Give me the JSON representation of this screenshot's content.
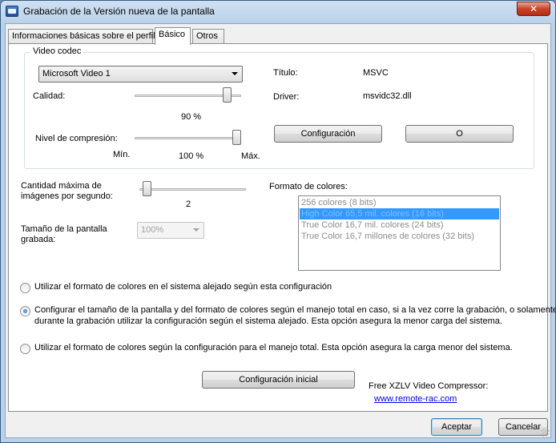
{
  "window": {
    "title": "Grabación de la Versión nueva de la pantalla",
    "close_label": "✕"
  },
  "tabs": [
    {
      "label": "Informaciones básicas sobre el perfil"
    },
    {
      "label": "Básico"
    },
    {
      "label": "Otros"
    }
  ],
  "video_codec": {
    "legend": "Video codec",
    "codec_value": "Microsoft Video 1",
    "quality_label": "Calidad:",
    "quality_value": "90 %",
    "compression_label": "Nivel de compresión:",
    "compression_value": "100 %",
    "min_label": "Mín.",
    "max_label": "Máx.",
    "title_label": "Título:",
    "title_value": "MSVC",
    "driver_label": "Driver:",
    "driver_value": "msvidc32.dll",
    "config_button": "Configuración",
    "o_button": "O"
  },
  "sliders": {
    "quality_level": 0.9,
    "compression_level": 1.0,
    "fps_level": 0.03
  },
  "fps": {
    "label_line1": "Cantidad máxima de",
    "label_line2": "imágenes por segundo:",
    "value": "2"
  },
  "screen_size": {
    "label_line1": "Tamaño de la pantalla",
    "label_line2": "grabada:",
    "value": "100%"
  },
  "color_format": {
    "label": "Formato de colores:",
    "items": [
      "256 colores (8 bits)",
      "High Color 65,5 mil. colores (16 bits)",
      "True Color 16,7 mil. colores (24 bits)",
      "True Color 16,7 millones de colores (32 bits)"
    ],
    "selected_index": 1
  },
  "options": [
    {
      "line1": "Utilizar el formato de colores en el sistema alejado según esta configuración",
      "line2": "",
      "checked": false
    },
    {
      "line1": "Configurar el tamaño de la pantalla y del formato de colores según el manejo total en caso, si a la vez corre la grabación, o solamente",
      "line2": "durante la grabación utilizar la configuración según el sistema alejado. Esta opción asegura la menor carga del sistema.",
      "checked": true
    },
    {
      "line1": "Utilizar el formato de colores según la configuración para el manejo total. Esta opción asegura la carga menor del sistema.",
      "line2": "",
      "checked": false
    }
  ],
  "initial_config_button": "Configuración inicial",
  "promo": {
    "text": "Free XZLV Video Compressor:",
    "link": "www.remote-rac.com"
  },
  "footer": {
    "accept": "Aceptar",
    "cancel": "Cancelar"
  },
  "colors": {
    "selection": "#3399ff",
    "link": "#0000ee",
    "close_button": "#c7452b"
  }
}
